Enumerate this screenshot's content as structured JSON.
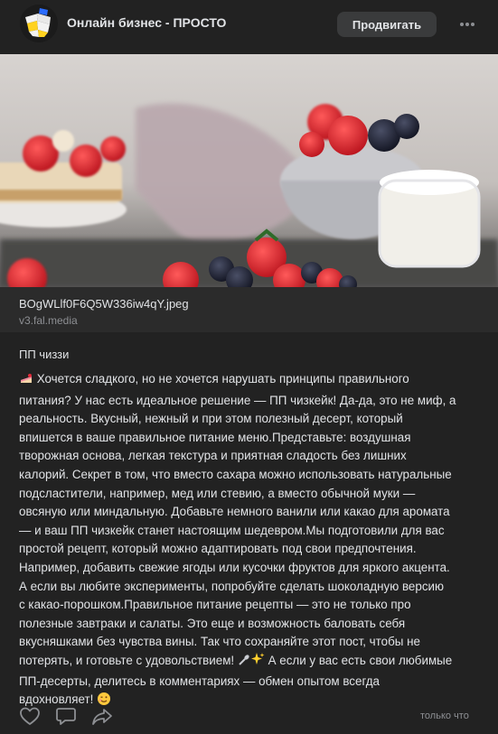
{
  "header": {
    "community_name": "Онлайн бизнес - ПРОСТО",
    "promote_label": "Продвигать"
  },
  "link_card": {
    "title": "BOgWLlf0F6Q5W336iw4qY.jpeg",
    "domain": "v3.fal.media"
  },
  "post": {
    "heading": "ПП чиззи",
    "body_lines": [
      "Хочется сладкого, но не хочется нарушать принципы правильного",
      "питания? У нас есть идеальное решение — ПП чизкейк! Да-да, это не миф, а",
      "реальность. Вкусный, нежный и при этом полезный десерт, который",
      "впишется в ваше правильное питание меню.Представьте: воздушная",
      "творожная основа, легкая текстура и приятная сладость без лишних",
      "калорий. Секрет в том, что вместо сахара можно использовать натуральные",
      "подсластители, например, мед или стевию, а вместо обычной муки —",
      "овсяную или миндальную. Добавьте немного ванили или какао для аромата",
      "— и ваш ПП чизкейк станет настоящим шедевром.Мы подготовили для вас",
      "простой рецепт, который можно адаптировать под свои предпочтения.",
      "Например, добавить свежие ягоды или кусочки фруктов для яркого акцента.",
      "А если вы любите эксперименты, попробуйте сделать шоколадную версию",
      "с какао-порошком.Правильное питание рецепты — это не только про",
      "полезные завтраки и салаты. Это еще и возможность баловать себя",
      "вкусняшками без чувства вины. Так что сохраняйте этот пост, чтобы не",
      "потерять, и готовьте с удовольствием!",
      "А если у вас есть свои любимые",
      "ПП-десерты, делитесь в комментариях — обмен опытом всегда",
      "вдохновляет!"
    ]
  },
  "footer": {
    "label": "только что"
  },
  "icons": {
    "more": "more-dots-icon",
    "like": "heart-icon",
    "comment": "comment-icon",
    "share": "share-icon"
  },
  "colors": {
    "background": "#222222",
    "card_background": "#2b2b2b",
    "button_background": "#3a3b3c",
    "text": "#e1e3e6",
    "muted_text": "#8d8f93"
  }
}
